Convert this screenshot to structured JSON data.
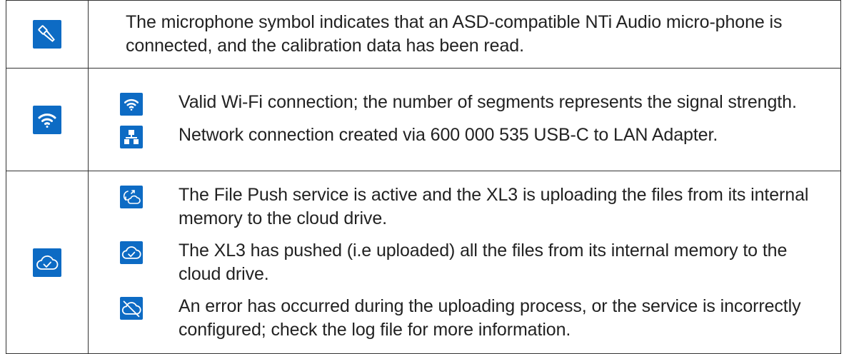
{
  "rows": [
    {
      "icon": "microphone-icon",
      "text": "The microphone symbol indicates that an ASD-compatible NTi Audio micro-phone is connected, and the calibration data has been read."
    },
    {
      "icon": "wifi-icon",
      "items": [
        {
          "icon": "wifi-icon",
          "text": "Valid Wi-Fi connection; the number of segments represents the signal strength."
        },
        {
          "icon": "lan-network-icon",
          "text": "Network connection created via 600 000 535 USB-C to LAN Adapter."
        }
      ]
    },
    {
      "icon": "cloud-check-icon",
      "items": [
        {
          "icon": "cloud-sync-icon",
          "text": "The File Push service is active and the XL3 is uploading the files from its internal memory to the cloud drive."
        },
        {
          "icon": "cloud-check-icon",
          "text": "The XL3 has pushed (i.e uploaded) all the files from its internal memory to the cloud drive."
        },
        {
          "icon": "cloud-off-icon",
          "text": "An error has occurred during the uploading process, or the service is incorrectly configured; check the log file for more information."
        }
      ]
    }
  ],
  "colors": {
    "icon_background": "#0d6bc4",
    "icon_foreground": "#ffffff",
    "border": "#333333",
    "text": "#222222"
  }
}
